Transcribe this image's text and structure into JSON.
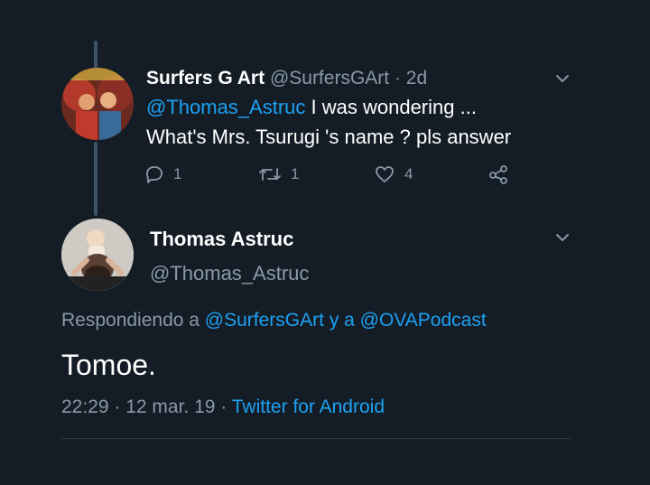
{
  "tweet1": {
    "display_name": "Surfers G Art",
    "handle": "@SurfersGArt",
    "time": "· 2d",
    "mention": "@Thomas_Astruc",
    "text_line1": "I was wondering ...",
    "text_line2": "What's Mrs. Tsurugi 's name ? pls answer",
    "reply_count": "1",
    "retweet_count": "1",
    "like_count": "4"
  },
  "tweet2": {
    "display_name": "Thomas Astruc",
    "handle": "@Thomas_Astruc",
    "replying_prefix": "Respondiendo a ",
    "replying_user1": "@SurfersGArt",
    "replying_middle": " y a ",
    "replying_user2": "@OVAPodcast",
    "text": "Tomoe.",
    "time": "22:29",
    "date_sep": " · ",
    "date": "12 mar. 19",
    "source_sep": " · ",
    "source": "Twitter for Android"
  },
  "colors": {
    "background": "#141d26",
    "link": "#1da1f2",
    "muted": "#8899a6"
  },
  "icons": [
    "reply-icon",
    "retweet-icon",
    "like-icon",
    "share-icon",
    "chevron-down-icon"
  ]
}
